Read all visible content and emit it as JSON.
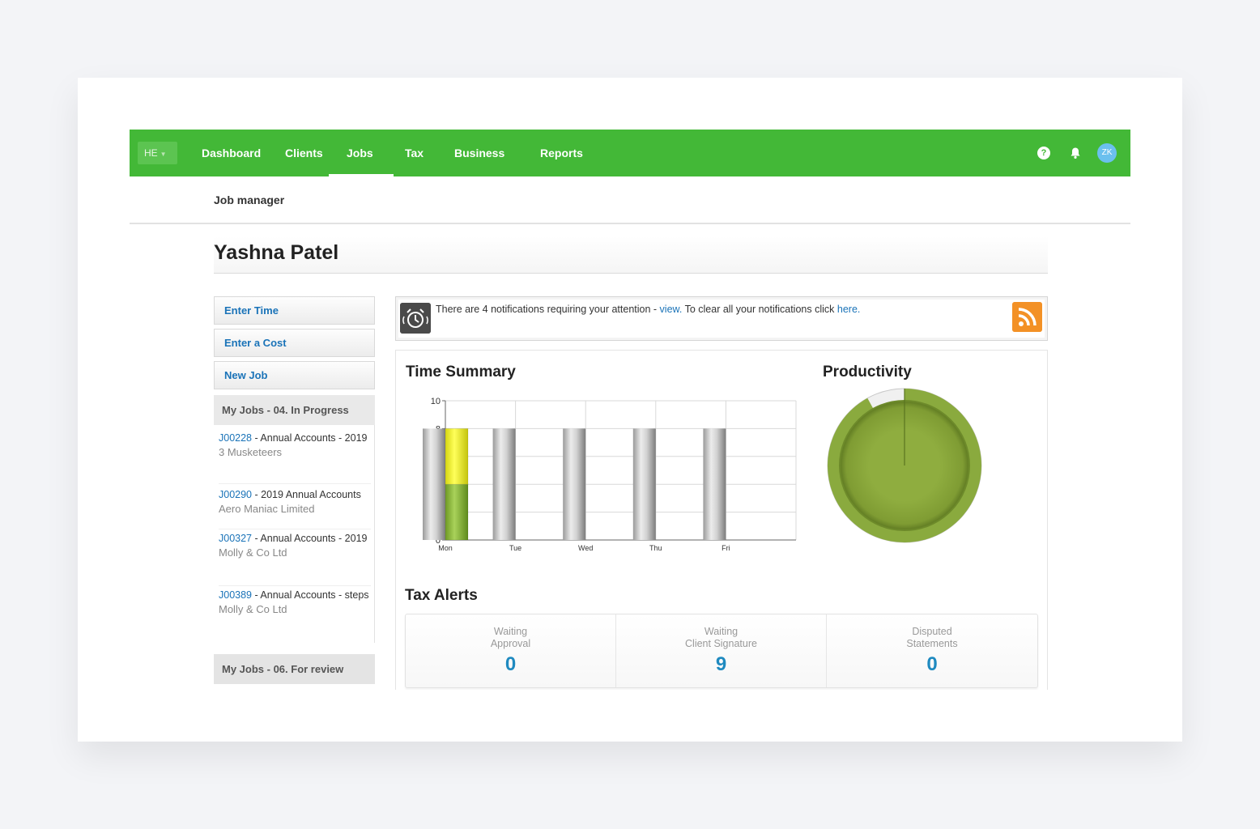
{
  "nav": {
    "org": "HE",
    "items": [
      "Dashboard",
      "Clients",
      "Jobs",
      "Tax",
      "Business",
      "Reports"
    ],
    "active": "Jobs",
    "user_initials": "ZK",
    "help_glyph": "?"
  },
  "subheader": {
    "title": "Job manager"
  },
  "page": {
    "title": "Yashna Patel"
  },
  "sidebar": {
    "buttons": [
      "Enter Time",
      "Enter a Cost",
      "New Job"
    ],
    "sections": [
      {
        "title": "My Jobs - 04. In Progress",
        "jobs": [
          {
            "code": "J00228",
            "name": " - Annual Accounts - 2019",
            "client": "3 Musketeers"
          },
          {
            "code": "J00290",
            "name": " - 2019 Annual Accounts",
            "client": "Aero Maniac Limited"
          },
          {
            "code": "J00327",
            "name": " - Annual Accounts - 2019",
            "client": "Molly & Co Ltd"
          },
          {
            "code": "J00389",
            "name": " - Annual Accounts - steps",
            "client": "Molly & Co Ltd"
          }
        ]
      },
      {
        "title": "My Jobs - 06. For review",
        "jobs": []
      }
    ]
  },
  "notification": {
    "text": "There are 4 notifications requiring your attention - ",
    "view_link": "view.",
    "text2": " To clear all your notifications click ",
    "here_link": "here."
  },
  "time_summary": {
    "title": "Time Summary",
    "chart_data": {
      "type": "bar",
      "categories": [
        "Mon",
        "Tue",
        "Wed",
        "Thu",
        "Fri"
      ],
      "ylim": [
        0,
        10
      ],
      "yticks": [
        0,
        2,
        4,
        6,
        8,
        10
      ],
      "capacity": [
        8,
        8,
        8,
        8,
        8
      ],
      "series": [
        {
          "values": [
            4,
            0,
            0,
            0,
            0
          ],
          "color": "#8ab83a"
        },
        {
          "values": [
            4,
            0,
            0,
            0,
            0
          ],
          "color": "#f2f230"
        }
      ],
      "grid": true
    }
  },
  "productivity": {
    "title": "Productivity",
    "chart_data": {
      "type": "pie",
      "gauge_fraction": 0.92,
      "color": "#8aaa3e"
    }
  },
  "tax_alerts": {
    "title": "Tax Alerts",
    "cells": [
      {
        "label1": "Waiting",
        "label2": "Approval",
        "value": "0"
      },
      {
        "label1": "Waiting",
        "label2": "Client Signature",
        "value": "9"
      },
      {
        "label1": "Disputed",
        "label2": "Statements",
        "value": "0"
      }
    ]
  },
  "colors": {
    "nav_green": "#43b837",
    "link_blue": "#1a73b8",
    "value_blue": "#1f8ac0",
    "rss_orange": "#f39126"
  }
}
